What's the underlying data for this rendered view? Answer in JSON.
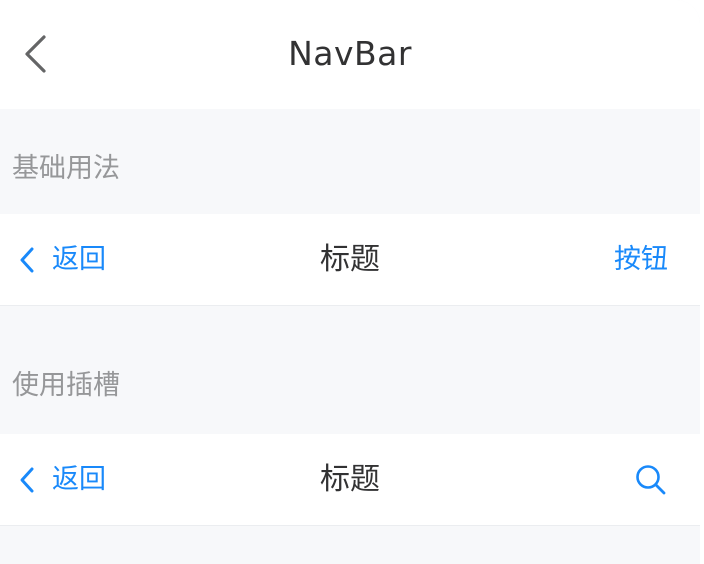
{
  "page": {
    "title": "NavBar",
    "back_icon": "chevron-left-icon"
  },
  "sections": [
    {
      "heading": "基础用法",
      "navbar": {
        "left_icon": "chevron-left-icon",
        "left_text": "返回",
        "title": "标题",
        "right_text": "按钮"
      }
    },
    {
      "heading": "使用插槽",
      "navbar": {
        "left_icon": "chevron-left-icon",
        "left_text": "返回",
        "title": "标题",
        "right_icon": "search-icon"
      }
    }
  ],
  "colors": {
    "accent": "#1989fa",
    "text_primary": "#323233",
    "text_secondary": "#969799",
    "background": "#f7f8fa",
    "surface": "#ffffff"
  }
}
